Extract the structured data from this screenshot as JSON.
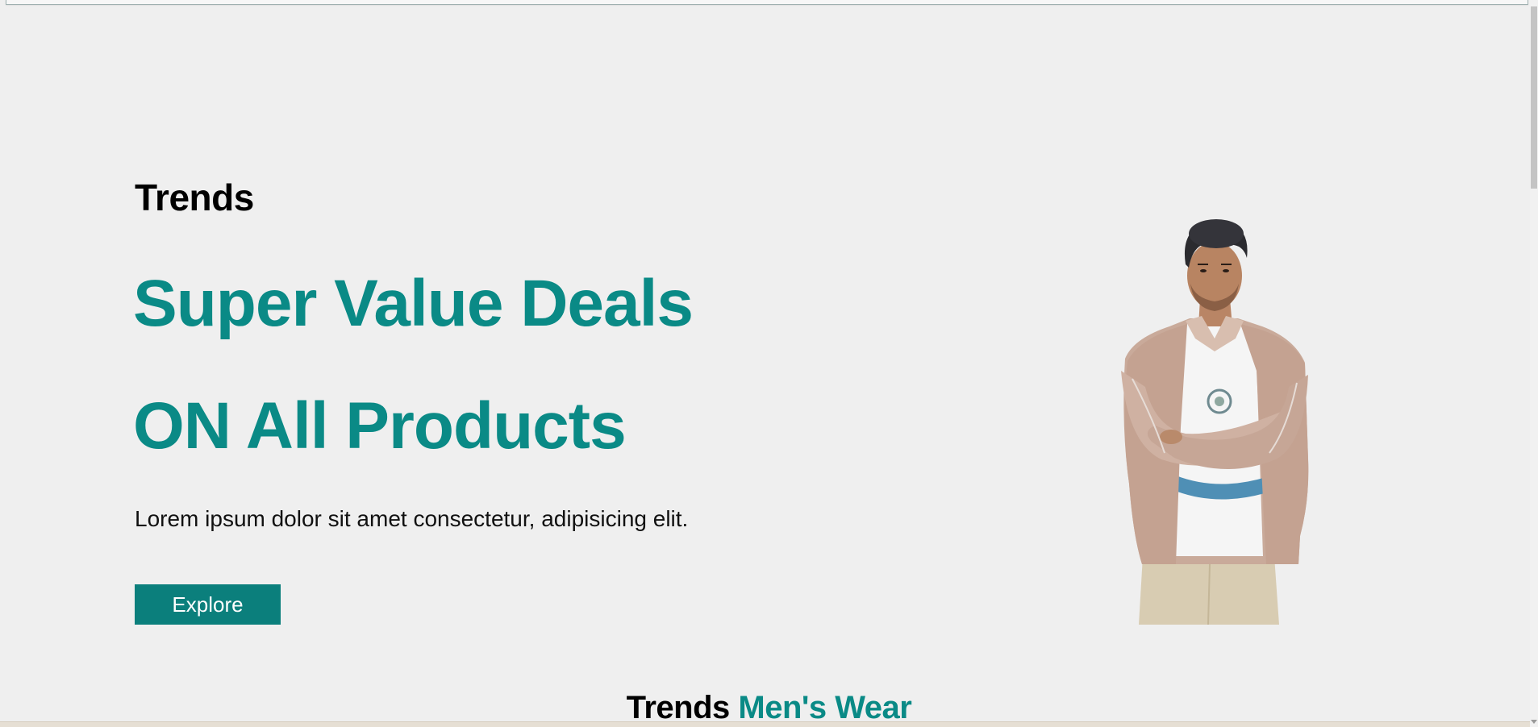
{
  "hero": {
    "brand": "Trends",
    "title_line1": "Super Value Deals",
    "title_line2": "ON All Products",
    "description": "Lorem ipsum dolor sit amet consectetur, adipisicing elit.",
    "cta_label": "Explore"
  },
  "section": {
    "title_main": "Trends",
    "title_accent": "Men's Wear"
  },
  "colors": {
    "accent": "#0a8a86",
    "button": "#0b7f7c",
    "background": "#efefef"
  }
}
